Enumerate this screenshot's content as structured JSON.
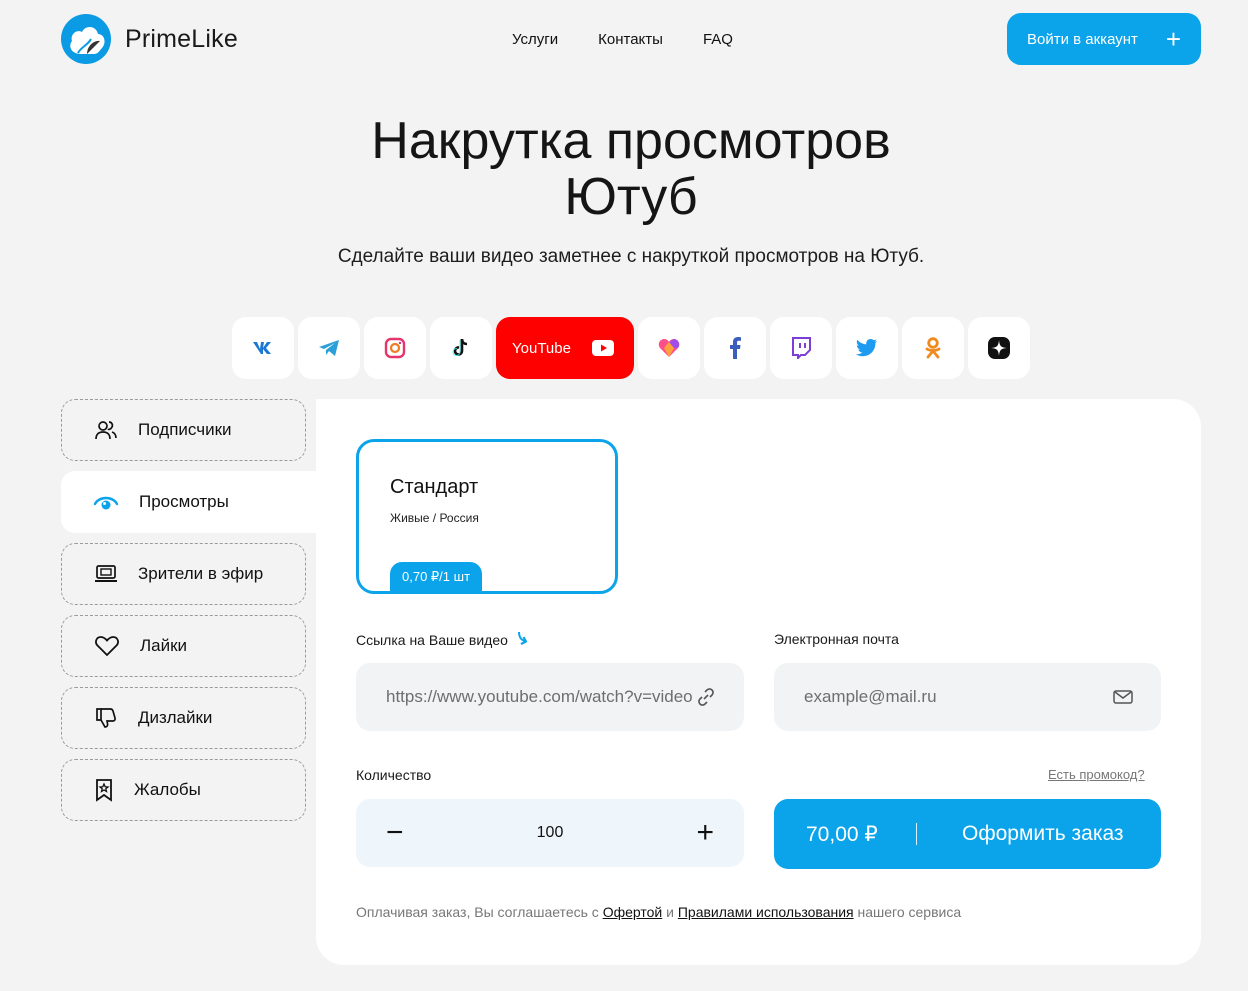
{
  "header": {
    "logo_text": "PrimeLike",
    "nav": [
      "Услуги",
      "Контакты",
      "FAQ"
    ],
    "login_label": "Войти в аккаунт",
    "login_icon": "plus-icon"
  },
  "hero": {
    "title_line1": "Накрутка просмотров",
    "title_line2": "Ютуб",
    "subtitle": "Сделайте ваши видео заметнее с накруткой просмотров на Ютуб."
  },
  "platforms": {
    "items": [
      "vk-icon",
      "telegram-icon",
      "instagram-icon",
      "tiktok-icon",
      "youtube-icon",
      "likee-icon",
      "facebook-icon",
      "twitch-icon",
      "twitter-icon",
      "odnoklassniki-icon",
      "zen-icon"
    ],
    "active_label": "YouTube"
  },
  "categories": [
    {
      "label": "Подписчики",
      "icon": "users-icon"
    },
    {
      "label": "Просмотры",
      "icon": "eye-icon",
      "active": true
    },
    {
      "label": "Зрители в эфир",
      "icon": "laptop-icon"
    },
    {
      "label": "Лайки",
      "icon": "heart-icon"
    },
    {
      "label": "Дизлайки",
      "icon": "thumbs-down-icon"
    },
    {
      "label": "Жалобы",
      "icon": "report-icon"
    }
  ],
  "tariff": {
    "title": "Стандарт",
    "desc": "Живые / Россия",
    "price": "0,70 ₽/1 шт"
  },
  "form": {
    "link_label": "Ссылка на Ваше видео",
    "link_placeholder": "https://www.youtube.com/watch?v=video",
    "email_label": "Электронная почта",
    "email_placeholder": "example@mail.ru",
    "qty_label": "Количество",
    "promo_label": "Есть промокод?",
    "qty_value": "100",
    "total": "70,00 ₽",
    "order_label": "Оформить заказ"
  },
  "legal": {
    "prefix": "Оплачивая заказ, Вы соглашаетесь с",
    "offer": "Офертой",
    "and": "и",
    "rules": "Правилами использования",
    "suffix": "нашего сервиса"
  },
  "colors": {
    "accent": "#0ba4ea",
    "youtube": "#ff0000",
    "background": "#f3f3f3"
  }
}
